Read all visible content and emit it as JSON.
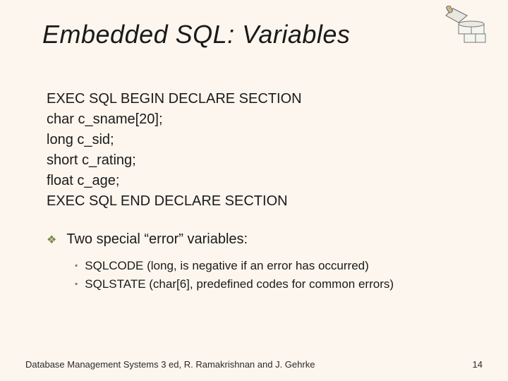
{
  "title": "Embedded SQL: Variables",
  "code": {
    "l0": "EXEC SQL BEGIN DECLARE SECTION",
    "l1": "char c_sname[20];",
    "l2": "long c_sid;",
    "l3": "short c_rating;",
    "l4": "float c_age;",
    "l5": "EXEC SQL END DECLARE SECTION"
  },
  "bullet_main": "Two special “error” variables:",
  "sub": {
    "s0": "SQLCODE (long, is negative if an error has occurred)",
    "s1": "SQLSTATE (char[6], predefined codes for common errors)"
  },
  "footer_left": "Database Management Systems 3 ed,  R. Ramakrishnan and J. Gehrke",
  "footer_right": "14"
}
